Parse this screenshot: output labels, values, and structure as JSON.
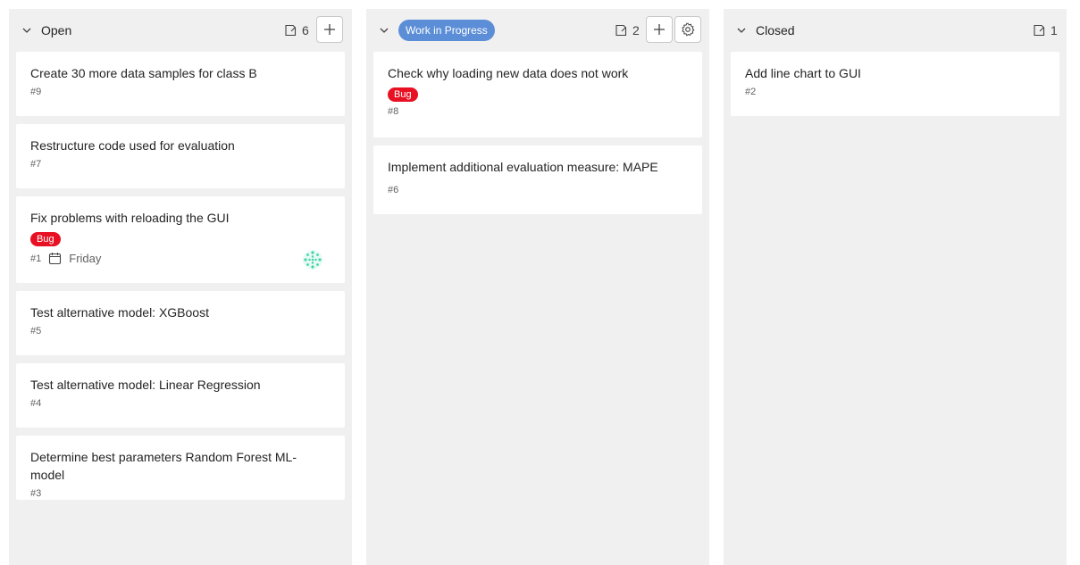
{
  "columns": [
    {
      "title": "Open",
      "count": "6",
      "cards": [
        {
          "title": "Create 30 more data samples for class B",
          "number": "#9"
        },
        {
          "title": "Restructure code used for evaluation",
          "number": "#7"
        },
        {
          "title": "Fix problems with reloading the GUI",
          "tag": "Bug",
          "number": "#1",
          "due": "Friday"
        },
        {
          "title": "Test alternative model: XGBoost",
          "number": "#5"
        },
        {
          "title": "Test alternative model: Linear Regression",
          "number": "#4"
        },
        {
          "title": "Determine best parameters Random Forest ML-model",
          "number": "#3"
        }
      ]
    },
    {
      "title": "Work in Progress",
      "count": "2",
      "cards": [
        {
          "title": "Check why loading new data does not work",
          "tag": "Bug",
          "number": "#8"
        },
        {
          "title": "Implement additional evaluation measure: MAPE",
          "number": "#6"
        }
      ]
    },
    {
      "title": "Closed",
      "count": "1",
      "cards": [
        {
          "title": "Add line chart to GUI",
          "number": "#2"
        }
      ]
    }
  ],
  "colors": {
    "bug_tag": "#e81123",
    "wip_pill": "#5b8ed6",
    "column_bg": "#f0f0f0"
  },
  "icons": [
    "chevron-down-icon",
    "card-count-icon",
    "plus-icon",
    "gear-icon",
    "calendar-icon",
    "avatar"
  ]
}
